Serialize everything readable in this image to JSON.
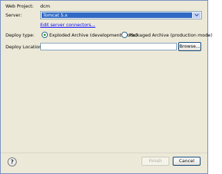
{
  "form": {
    "web_project_label": "Web Project:",
    "web_project_value": "dcm",
    "server_label": "Server:",
    "server_value": "Tomcat  5.x",
    "edit_connectors_link": "Edit server connectors...",
    "deploy_type_label": "Deploy type:",
    "deploy_options": [
      {
        "label": "Exploded Archive (development mode)",
        "selected": true
      },
      {
        "label": "Packaged Archive (production mode)",
        "selected": false
      }
    ],
    "deploy_location_label": "Deploy Location:",
    "deploy_location_value": "",
    "browse_label": "Browse..."
  },
  "footer": {
    "help_icon": "question-mark-icon",
    "finish_label": "Finish",
    "cancel_label": "Cancel"
  }
}
